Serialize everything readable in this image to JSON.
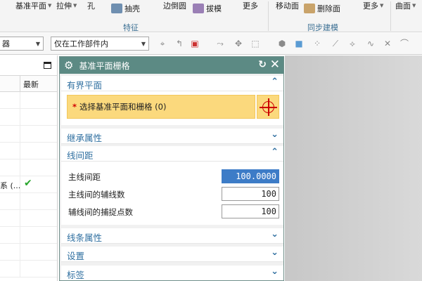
{
  "ribbon": {
    "items": [
      "基准平面",
      "拉伸",
      "孔",
      "抽壳",
      "边倒圆",
      "拔模",
      "更多",
      "移动面",
      "删除面",
      "更多",
      "曲面"
    ],
    "groups": [
      "特征",
      "同步建模"
    ]
  },
  "toolbar2": {
    "filter_combo": "器",
    "scope_combo": "仅在工作部件内"
  },
  "navigator": {
    "col_latest": "最新",
    "row_text": "系 (...",
    "row_check": "✔"
  },
  "dialog": {
    "title": "基准平面栅格",
    "sections": {
      "bounded_plane": "有界平面",
      "inherit": "继承属性",
      "line_spacing": "线间距",
      "line_props": "线条属性",
      "settings": "设置",
      "label": "标签"
    },
    "select_text": "选择基准平面和栅格 (0)",
    "fields": {
      "major_spacing_label": "主线间距",
      "major_spacing_value": "100.0000",
      "minor_lines_label": "主线间的辅线数",
      "minor_lines_value": "100",
      "snap_points_label": "辅线间的捕捉点数",
      "snap_points_value": "100"
    }
  },
  "colors": {
    "dialog_title_bg": "#5c8a84",
    "selection_bar": "#fbd97d",
    "section_label": "#2f6fa0",
    "check": "#27a52b"
  },
  "icons": [
    "gear-icon",
    "reset-icon",
    "close-icon",
    "crosshair-icon",
    "chevron-up-icon",
    "chevron-down-icon",
    "checkmark-icon"
  ]
}
